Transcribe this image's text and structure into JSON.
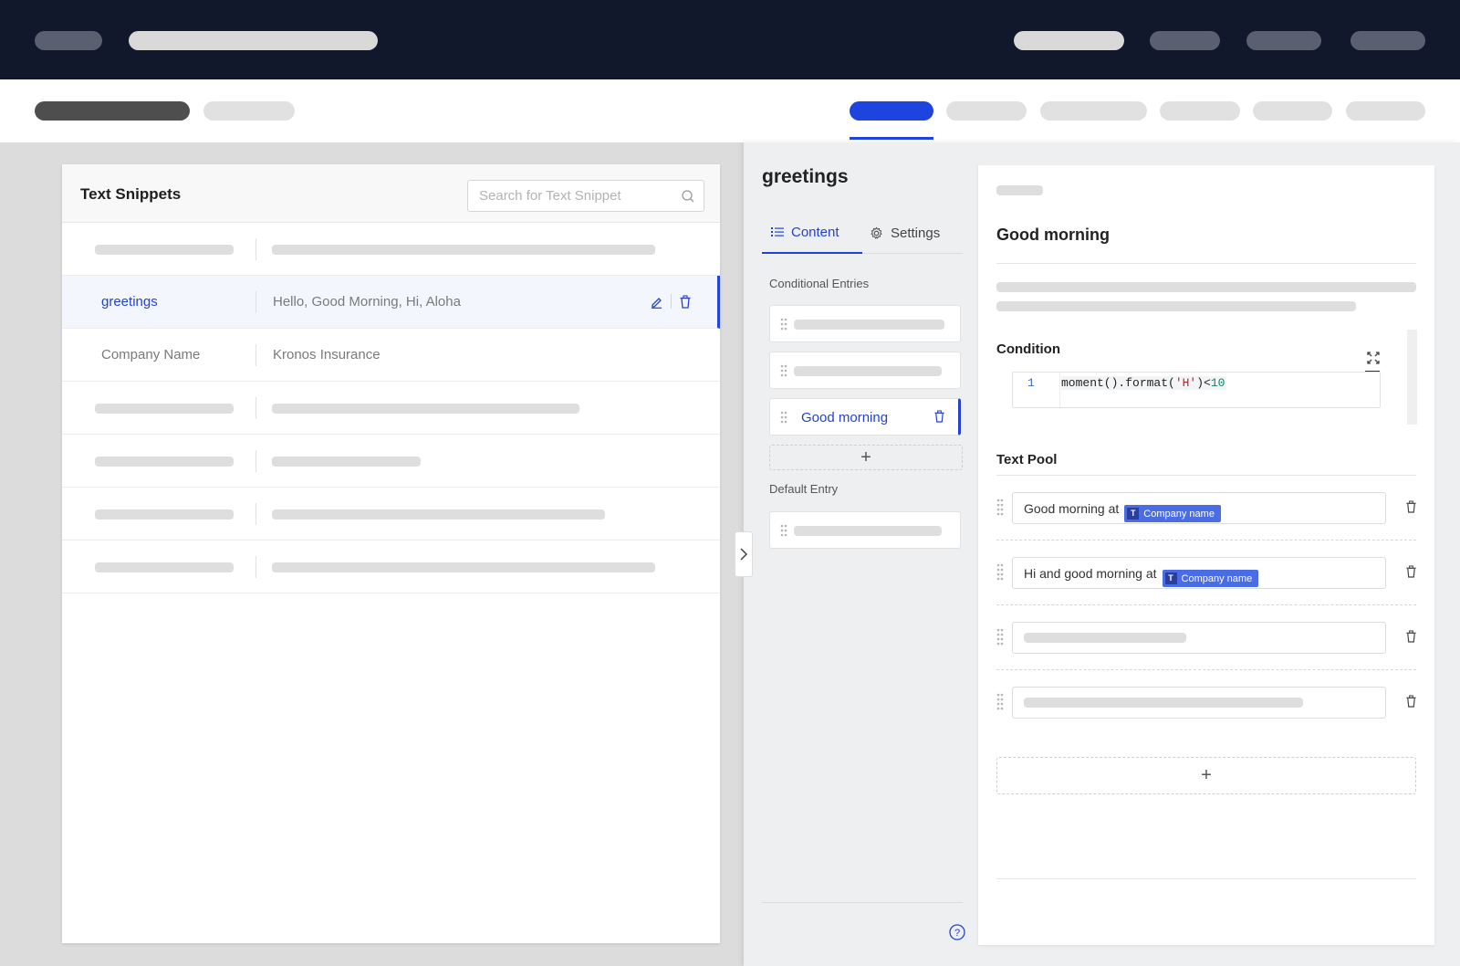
{
  "left_panel": {
    "title": "Text Snippets",
    "search_placeholder": "Search for Text Snippet",
    "rows": [
      {
        "name": "greetings",
        "value": "Hello, Good Morning, Hi, Aloha",
        "selected": true
      },
      {
        "name": "Company Name",
        "value": "Kronos Insurance",
        "selected": false
      }
    ]
  },
  "editor": {
    "snippet_name": "greetings",
    "tabs": {
      "content": "Content",
      "settings": "Settings"
    },
    "conditional_entries_label": "Conditional Entries",
    "selected_entry": "Good morning",
    "default_entry_label": "Default Entry"
  },
  "detail": {
    "title": "Good morning",
    "condition_label": "Condition",
    "code": {
      "line_number": "1",
      "part1": "moment().format(",
      "string": "'H'",
      "part2": ")<",
      "number": "10"
    },
    "text_pool_label": "Text Pool",
    "pool_items": [
      {
        "text": "Good morning at",
        "token": "Company name"
      },
      {
        "text": "Hi and good morning at",
        "token": "Company name"
      }
    ],
    "token_type_letter": "T"
  },
  "colors": {
    "topbar": "#11182b",
    "accent": "#2342d4",
    "token": "#4a6de5"
  }
}
